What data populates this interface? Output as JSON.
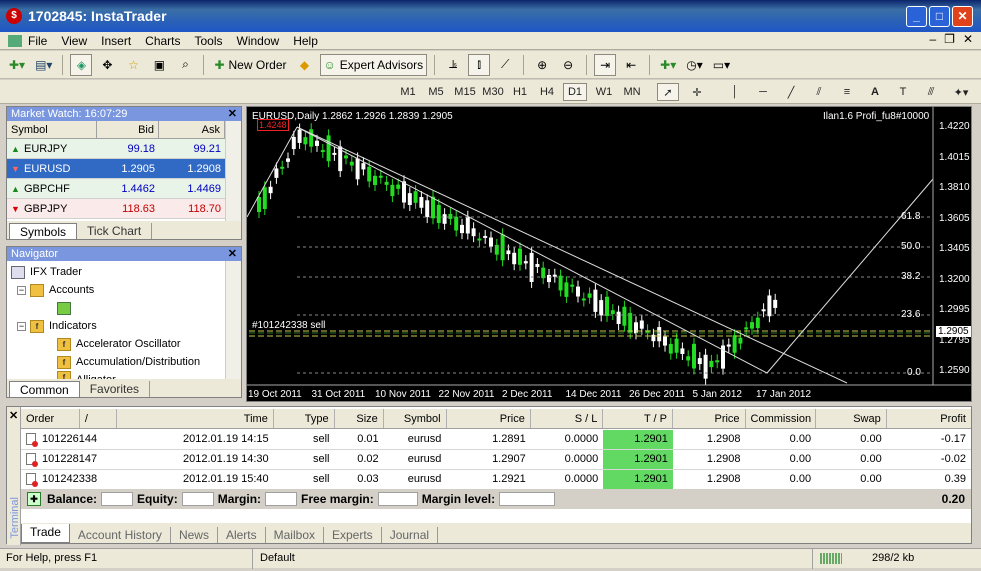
{
  "window": {
    "title": "1702845: InstaTrader"
  },
  "menu": [
    "File",
    "View",
    "Insert",
    "Charts",
    "Tools",
    "Window",
    "Help"
  ],
  "toolbar": {
    "new_order": "New Order",
    "expert_advisors": "Expert Advisors"
  },
  "timeframes": [
    "M1",
    "M5",
    "M15",
    "M30",
    "H1",
    "H4",
    "D1",
    "W1",
    "MN"
  ],
  "selected_timeframe": "D1",
  "market_watch": {
    "title": "Market Watch: 16:07:29",
    "columns": [
      "Symbol",
      "Bid",
      "Ask"
    ],
    "rows": [
      {
        "symbol": "EURJPY",
        "bid": "99.18",
        "ask": "99.21",
        "dir": "up"
      },
      {
        "symbol": "EURUSD",
        "bid": "1.2905",
        "ask": "1.2908",
        "dir": "down"
      },
      {
        "symbol": "GBPCHF",
        "bid": "1.4462",
        "ask": "1.4469",
        "dir": "up"
      },
      {
        "symbol": "GBPJPY",
        "bid": "118.63",
        "ask": "118.70",
        "dir": "down"
      }
    ],
    "tabs": [
      "Symbols",
      "Tick Chart"
    ]
  },
  "navigator": {
    "title": "Navigator",
    "items": [
      "IFX Trader",
      "Accounts",
      "Indicators",
      "Accelerator Oscillator",
      "Accumulation/Distribution",
      "Alligator"
    ],
    "tabs": [
      "Common",
      "Favorites"
    ]
  },
  "chart": {
    "header": "EURUSD,Daily  1.2862 1.2926 1.2839 1.2905",
    "expert": "Ilan1.6 Profi_fu8#10000",
    "high_label": "1.4248",
    "order_label": "#101242338 sell",
    "price_tag": "1.2905",
    "fibo_levels": [
      "61.8",
      "50.0",
      "38.2",
      "23.6",
      "0.0"
    ],
    "y_ticks": [
      "1.4220",
      "1.4015",
      "1.3810",
      "1.3605",
      "1.3405",
      "1.3200",
      "1.2995",
      "1.2795",
      "1.2590"
    ],
    "x_ticks": [
      "19 Oct 2011",
      "31 Oct 2011",
      "10 Nov 2011",
      "22 Nov 2011",
      "2 Dec 2011",
      "14 Dec 2011",
      "26 Dec 2011",
      "5 Jan 2012",
      "17 Jan 2012"
    ]
  },
  "terminal": {
    "label": "Terminal",
    "columns": [
      "Order",
      "/",
      "Time",
      "Type",
      "Size",
      "Symbol",
      "Price",
      "S / L",
      "T / P",
      "Price",
      "Commission",
      "Swap",
      "Profit"
    ],
    "orders": [
      {
        "order": "101226144",
        "time": "2012.01.19 14:15",
        "type": "sell",
        "size": "0.01",
        "symbol": "eurusd",
        "price": "1.2891",
        "sl": "0.0000",
        "tp": "1.2901",
        "cur": "1.2908",
        "commission": "0.00",
        "swap": "0.00",
        "profit": "-0.17"
      },
      {
        "order": "101228147",
        "time": "2012.01.19 14:30",
        "type": "sell",
        "size": "0.02",
        "symbol": "eurusd",
        "price": "1.2907",
        "sl": "0.0000",
        "tp": "1.2901",
        "cur": "1.2908",
        "commission": "0.00",
        "swap": "0.00",
        "profit": "-0.02"
      },
      {
        "order": "101242338",
        "time": "2012.01.19 15:40",
        "type": "sell",
        "size": "0.03",
        "symbol": "eurusd",
        "price": "1.2921",
        "sl": "0.0000",
        "tp": "1.2901",
        "cur": "1.2908",
        "commission": "0.00",
        "swap": "0.00",
        "profit": "0.39"
      }
    ],
    "balance_labels": [
      "Balance:",
      "Equity:",
      "Margin:",
      "Free margin:",
      "Margin level:"
    ],
    "total_profit": "0.20",
    "tabs": [
      "Trade",
      "Account History",
      "News",
      "Alerts",
      "Mailbox",
      "Experts",
      "Journal"
    ]
  },
  "status": {
    "help": "For Help, press F1",
    "profile": "Default",
    "traffic": "298/2 kb"
  }
}
